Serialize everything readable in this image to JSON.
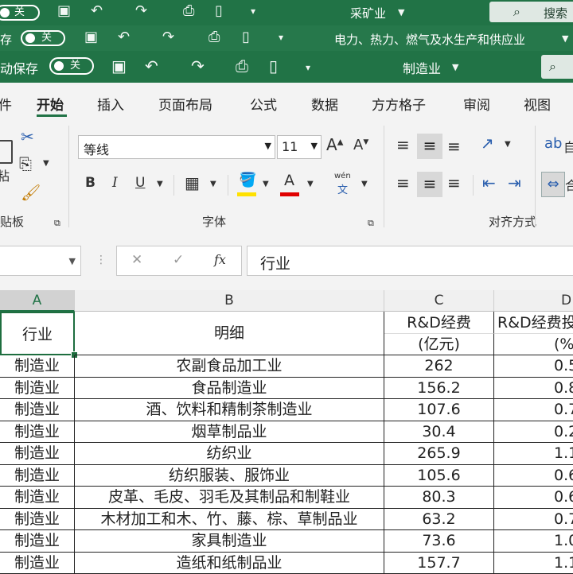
{
  "windows": [
    {
      "autosave_label": "",
      "toggle_text": "关",
      "title": "采矿业",
      "search": "搜索"
    },
    {
      "autosave_label": "存",
      "toggle_text": "关",
      "title": "电力、热力、燃气及水生产和供应业"
    },
    {
      "autosave_label": "动保存",
      "toggle_text": "关",
      "title": "制造业"
    }
  ],
  "ribbon_tabs": [
    "件",
    "开始",
    "插入",
    "页面布局",
    "公式",
    "数据",
    "方方格子",
    "审阅",
    "视图"
  ],
  "active_tab": "开始",
  "clipboard": {
    "paste_label": "粘",
    "group_label": "贴板"
  },
  "font": {
    "name": "等线",
    "size": "11",
    "group_label": "字体",
    "grow": "A",
    "shrink": "A",
    "bold": "B",
    "italic": "I",
    "underline": "U",
    "font_color_letter": "A",
    "phonetic_top": "wén",
    "phonetic_bottom": "文"
  },
  "alignment": {
    "group_label": "对齐方式",
    "wrap_label": "自",
    "merge_label": "合"
  },
  "formula_bar": {
    "cancel": "✕",
    "enter": "✓",
    "fx": "fx",
    "content": "行业"
  },
  "colors": {
    "excel_green": "#217346",
    "fill_yellow": "#ffe100",
    "font_red": "#e00000",
    "grid": "#222222"
  },
  "columns": [
    "A",
    "B",
    "C",
    "D"
  ],
  "header": {
    "a": "行业",
    "b": "明细",
    "c_top": "R&D经费",
    "c_bottom": "(亿元)",
    "d_top": "R&D经费投",
    "d_bottom": "(%)"
  },
  "rows": [
    {
      "industry": "制造业",
      "detail": "农副食品加工业",
      "rd": "262",
      "pct": "0.5"
    },
    {
      "industry": "制造业",
      "detail": "食品制造业",
      "rd": "156.2",
      "pct": "0.8"
    },
    {
      "industry": "制造业",
      "detail": "酒、饮料和精制茶制造业",
      "rd": "107.6",
      "pct": "0.7"
    },
    {
      "industry": "制造业",
      "detail": "烟草制品业",
      "rd": "30.4",
      "pct": "0.2"
    },
    {
      "industry": "制造业",
      "detail": "纺织业",
      "rd": "265.9",
      "pct": "1.1"
    },
    {
      "industry": "制造业",
      "detail": "纺织服装、服饰业",
      "rd": "105.6",
      "pct": "0.6"
    },
    {
      "industry": "制造业",
      "detail": "皮革、毛皮、羽毛及其制品和制鞋业",
      "rd": "80.3",
      "pct": "0.6"
    },
    {
      "industry": "制造业",
      "detail": "木材加工和木、竹、藤、棕、草制品业",
      "rd": "63.2",
      "pct": "0.7"
    },
    {
      "industry": "制造业",
      "detail": "家具制造业",
      "rd": "73.6",
      "pct": "1.0"
    },
    {
      "industry": "制造业",
      "detail": "造纸和纸制品业",
      "rd": "157.7",
      "pct": "1.1"
    }
  ]
}
